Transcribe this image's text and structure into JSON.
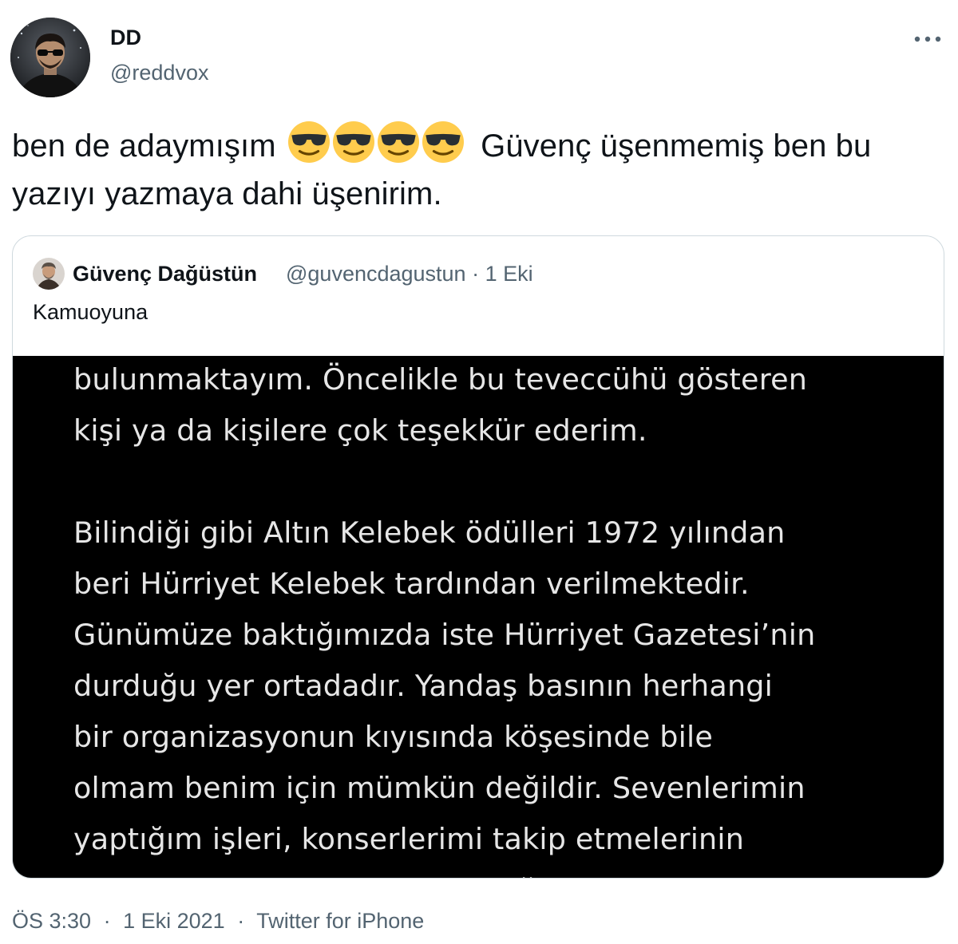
{
  "author": {
    "display_name": "DD",
    "handle": "@reddvox",
    "avatar": "avatar-photo"
  },
  "tweet": {
    "text_before_emoji": "ben de adaymışım",
    "emoji": [
      "smiling-face-with-sunglasses",
      "smiling-face-with-sunglasses",
      "smiling-face-with-sunglasses",
      "smiling-face-with-sunglasses"
    ],
    "text_after_emoji": "Güvenç üşenmemiş ben bu yazıyı yazmaya dahi üşenirim."
  },
  "quoted_tweet": {
    "display_name": "Güvenç Dağüstün",
    "handle_and_date": "@guvencdagustun · 1 Eki",
    "text": "Kamuoyuna",
    "image_text_lines": [
      "bulunmaktayım. Öncelikle bu teveccühü gösteren",
      "kişi ya da kişilere çok teşekkür ederim.",
      "",
      "Bilindiği gibi Altın Kelebek ödülleri 1972 yılından",
      "beri Hürriyet Kelebek tardından verilmektedir.",
      "Günümüze baktığımızda iste Hürriyet Gazetesi’nin",
      "durduğu yer ortadadır. Yandaş basının herhangi",
      "bir organizasyonun kıyısında köşesinde bile",
      "olmam benim için mümkün değildir. Sevenlerimin",
      "yaptığım işleri, konserlerimi takip etmelerinin",
      "benim için en büyük ödül olduğunu hatırlatır, bu"
    ],
    "image_background": "#000000",
    "image_text_color": "#e6e6e6"
  },
  "meta": {
    "time": "ÖS 3:30",
    "date": "1 Eki 2021",
    "separator": "·",
    "source": "Twitter for iPhone"
  },
  "icons": {
    "more": "more-horizontal-icon"
  },
  "colors": {
    "text_primary": "#0f1419",
    "text_secondary": "#536471",
    "border": "#cfd9de",
    "emoji_yellow": "#ffcc4d"
  }
}
